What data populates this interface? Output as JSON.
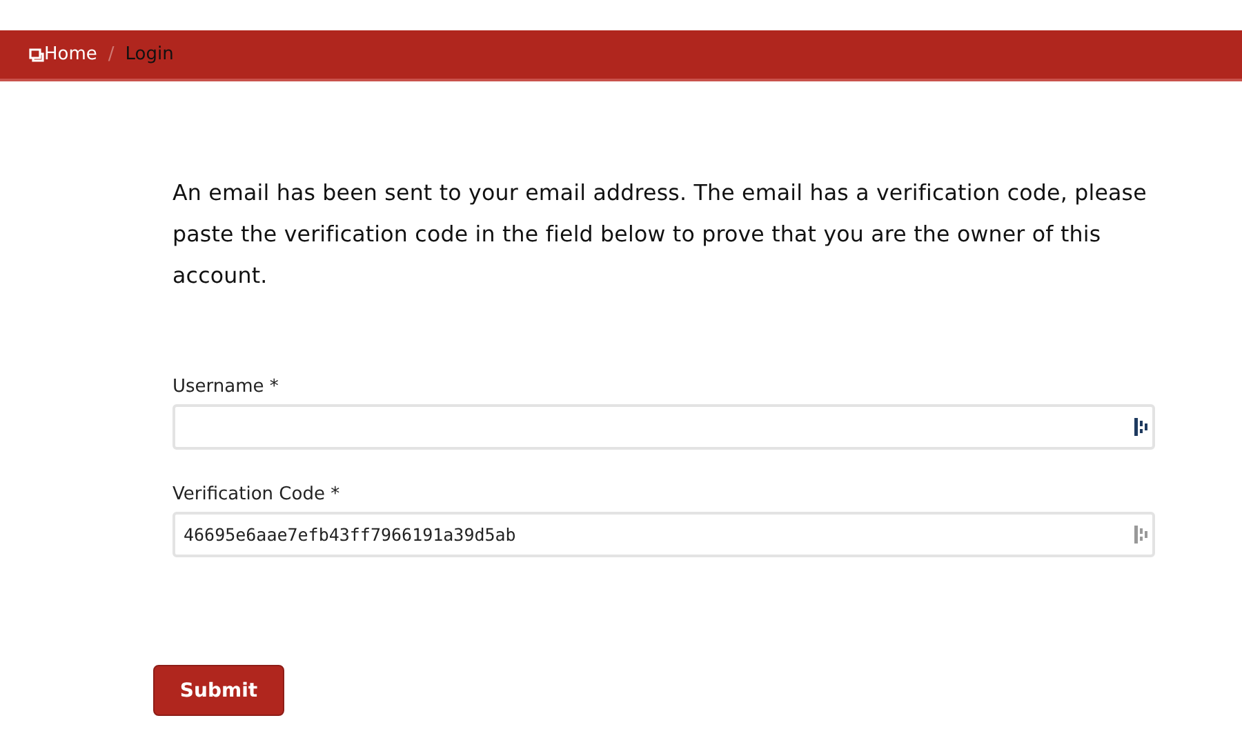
{
  "breadcrumb_separator": "/",
  "breadcrumb": [
    {
      "label": "Home",
      "kind": "link"
    },
    {
      "label": "Login",
      "kind": "current"
    }
  ],
  "message": "An email has been sent to your email address. The email has a verification code, please paste the verification code in the field below to prove that you are the owner of this account.",
  "fields": [
    {
      "label": "Username *",
      "focused": true
    },
    {
      "label": "Verification Code *",
      "value": "46695e6aae7efb43ff7966191a39d5ab",
      "focused": false
    }
  ],
  "submit": "Submit"
}
